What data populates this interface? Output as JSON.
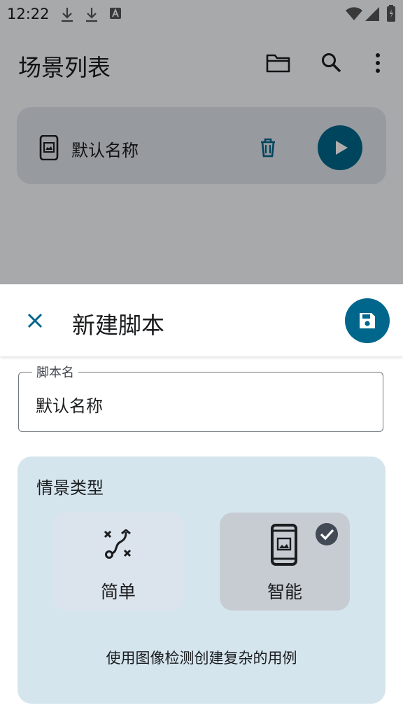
{
  "status_bar": {
    "time": "12:22"
  },
  "app_bar": {
    "title": "场景列表"
  },
  "scenario_list": [
    {
      "name": "默认名称"
    }
  ],
  "sheet": {
    "title": "新建脚本",
    "name_field": {
      "label": "脚本名",
      "value": "默认名称"
    },
    "scenario_type": {
      "label": "情景类型",
      "options": [
        {
          "label": "简单",
          "icon": "route-icon",
          "selected": false
        },
        {
          "label": "智能",
          "icon": "phone-image-icon",
          "selected": true
        }
      ],
      "description": "使用图像检测创建复杂的用例"
    }
  },
  "colors": {
    "accent": "#00668b",
    "card": "#d5e5ee"
  }
}
